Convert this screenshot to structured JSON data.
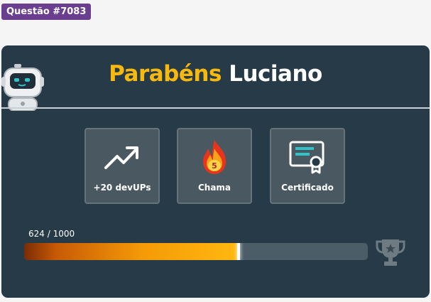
{
  "question_badge": "Questão #7083",
  "header": {
    "greeting": "Parabéns",
    "name": "Luciano"
  },
  "rewards": [
    {
      "label": "+20 devUPs",
      "icon": "trend-up-arrow-icon"
    },
    {
      "label": "Chama",
      "icon": "flame-icon",
      "value": "5"
    },
    {
      "label": "Certificado",
      "icon": "certificate-icon"
    }
  ],
  "progress": {
    "text": "624 / 1000",
    "fraction": 0.624
  },
  "colors": {
    "badge": "#6b3f8f",
    "card": "#263a47",
    "accent_gold": "#f8b90e",
    "flame_red": "#e8341c",
    "flame_orange": "#f8a21a",
    "certificate_teal": "#2ec4c9"
  }
}
